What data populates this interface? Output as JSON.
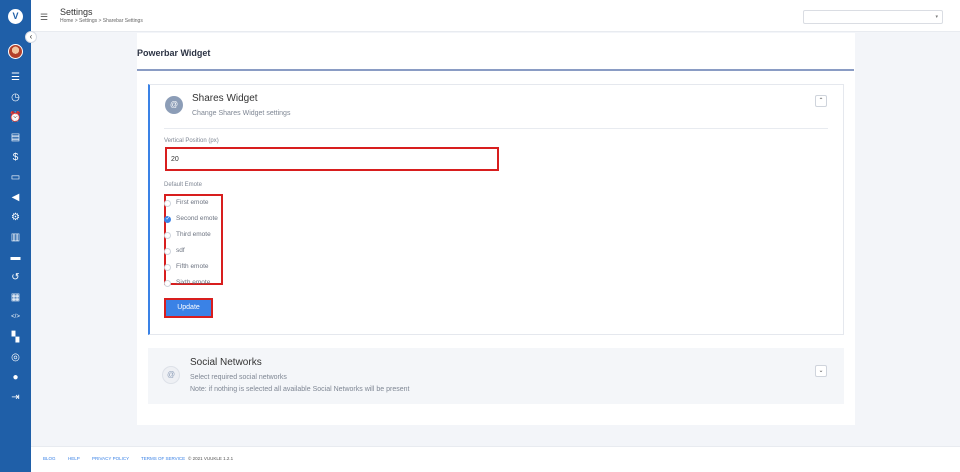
{
  "sidebar": {
    "logo_text": "V",
    "items": [
      {
        "icon": "list-icon",
        "glyph": "☰"
      },
      {
        "icon": "clock-icon",
        "glyph": "◷"
      },
      {
        "icon": "alarm-icon",
        "glyph": "⏰"
      },
      {
        "icon": "book-icon",
        "glyph": "▤"
      },
      {
        "icon": "dollar-icon",
        "glyph": "$"
      },
      {
        "icon": "id-card-icon",
        "glyph": "▭"
      },
      {
        "icon": "megaphone-icon",
        "glyph": "◀"
      },
      {
        "icon": "gear-icon",
        "glyph": "⚙"
      },
      {
        "icon": "chart-icon",
        "glyph": "▥"
      },
      {
        "icon": "credit-card-icon",
        "glyph": "▬"
      },
      {
        "icon": "history-icon",
        "glyph": "↺"
      },
      {
        "icon": "table-icon",
        "glyph": "▦"
      },
      {
        "icon": "code-icon",
        "glyph": "</>"
      },
      {
        "icon": "building-icon",
        "glyph": "▚"
      },
      {
        "icon": "support-icon",
        "glyph": "◎"
      },
      {
        "icon": "chat-icon",
        "glyph": "●"
      },
      {
        "icon": "logout-icon",
        "glyph": "⇥"
      }
    ],
    "toggle_glyph": "‹"
  },
  "header": {
    "menu_glyph": "☰",
    "title": "Settings",
    "breadcrumb": "Home > Settings > Sharebar Settings",
    "site_select": {
      "value": "",
      "arrow": "▾"
    }
  },
  "page": {
    "title": "Powerbar Widget"
  },
  "shares_widget": {
    "icon_glyph": "@",
    "title": "Shares Widget",
    "subtitle": "Change Shares Widget settings",
    "collapse_glyph": "⌃",
    "vertical_position_label": "Vertical Position (px)",
    "vertical_position_value": "20",
    "default_emote_label": "Default Emote",
    "emotes": [
      {
        "label": "First emote",
        "checked": false
      },
      {
        "label": "Second emote",
        "checked": true
      },
      {
        "label": "Third emote",
        "checked": false
      },
      {
        "label": "sdf",
        "checked": false
      },
      {
        "label": "Fifth emote",
        "checked": false
      },
      {
        "label": "Sixth emote",
        "checked": false
      }
    ],
    "update_label": "Update"
  },
  "social_networks": {
    "icon_glyph": "@",
    "title": "Social Networks",
    "subtitle": "Select required social networks",
    "note": "Note: if nothing is selected all available Social Networks will be present",
    "expand_glyph": "⌄"
  },
  "footer": {
    "links": [
      "Blog",
      "Help",
      "Privacy Policy",
      "Terms of Service"
    ],
    "copyright": "© 2021 VUUKLE 1.2.1"
  }
}
